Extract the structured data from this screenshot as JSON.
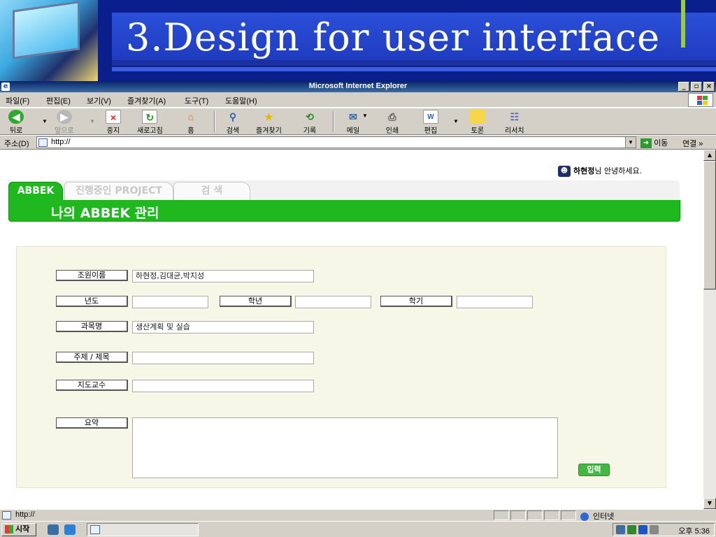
{
  "slide": {
    "title": "3.Design for user interface"
  },
  "window": {
    "title": "Microsoft Internet Explorer",
    "minimize": "_",
    "restore": "▫",
    "close": "×"
  },
  "menu": {
    "items": [
      {
        "label": "파일(F)"
      },
      {
        "label": "편집(E)"
      },
      {
        "label": "보기(V)"
      },
      {
        "label": "즐겨찾기(A)"
      },
      {
        "label": "도구(T)"
      },
      {
        "label": "도움말(H)"
      }
    ]
  },
  "toolbar": {
    "back": "뒤로",
    "forward": "앞으로",
    "stop": "중지",
    "refresh": "새로고침",
    "home": "홈",
    "search": "검색",
    "favorites": "즐겨찾기",
    "history": "기록",
    "mail": "메일",
    "print": "인쇄",
    "edit": "편집",
    "discuss": "토론",
    "messenger": "리서치"
  },
  "address": {
    "label": "주소(D)",
    "value": "http://",
    "go": "이동",
    "links": "연결 »"
  },
  "page": {
    "greeting_name": "하현정",
    "greeting_rest": "님 안녕하세요.",
    "tabs": [
      {
        "label": "ABBEK",
        "active": true
      },
      {
        "label": "진행중인 PROJECT",
        "active": false
      },
      {
        "label": "검 색",
        "active": false
      }
    ],
    "section_title": "나의 ABBEK 관리",
    "form": {
      "members_label": "조원이름",
      "members_value": "하현정,김대균,박지성",
      "year_label": "년도",
      "year_value": "",
      "grade_label": "학년",
      "grade_value": "",
      "semester_label": "학기",
      "semester_value": "",
      "course_label": "과목명",
      "course_value": "생산계획 및 실습",
      "topic_label": "주제 / 제목",
      "topic_value": "",
      "advisor_label": "지도교수",
      "advisor_value": "",
      "summary_label": "요약",
      "summary_value": "",
      "submit_label": "입력"
    }
  },
  "status": {
    "url": "http://",
    "zone": "인터넷"
  },
  "taskbar": {
    "start": "시작",
    "clock": "오후 5:36"
  },
  "colors": {
    "accent_green": "#1fb81f",
    "slide_blue": "#0a1e8c",
    "panel_bg": "#f7f7e8"
  }
}
